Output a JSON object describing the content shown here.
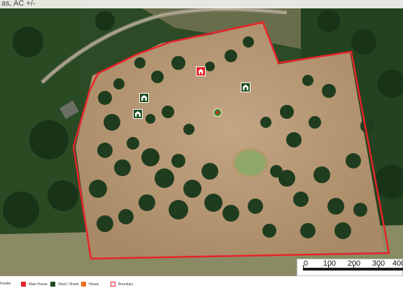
{
  "title": "as, AC +/-",
  "colors": {
    "boundary": "#e8232a",
    "main_house": "#e8232a",
    "shed": "#1f4d1f",
    "house": "#f26a1b",
    "pond": "#8fa86a",
    "field": "#b89a78",
    "trees": "#1e3a1e"
  },
  "markers": {
    "main_house": {
      "icon": "house-icon",
      "type": "Main House"
    },
    "sheds": [
      {
        "icon": "shed-icon",
        "type": "Shed / Shack"
      },
      {
        "icon": "shed-icon",
        "type": "Shed / Shack"
      },
      {
        "icon": "shed-icon",
        "type": "Shed / Shack"
      }
    ],
    "feeder": {
      "icon": "feeder-icon",
      "type": "Feeder"
    }
  },
  "scale": {
    "labels": [
      "0",
      "100",
      "200",
      "300",
      "400"
    ]
  },
  "legend": [
    {
      "label": "Feeder",
      "icon": "feeder-icon"
    },
    {
      "label": "Main House",
      "icon": "house-icon"
    },
    {
      "label": "Shed / Shack",
      "icon": "shed-icon"
    },
    {
      "label": "House",
      "icon": "home-icon"
    },
    {
      "label": "Boundary",
      "icon": "boundary-icon"
    }
  ]
}
